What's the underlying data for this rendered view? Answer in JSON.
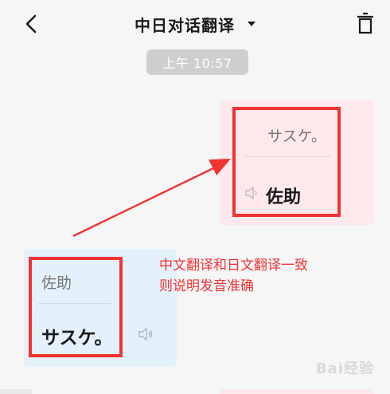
{
  "header": {
    "title": "中日对话翻译",
    "back_icon": "chevron-left-icon",
    "dropdown_icon": "caret-down-icon",
    "delete_icon": "trash-icon"
  },
  "timestamp": "上午 10:57",
  "messages": [
    {
      "side": "right",
      "source_text": "サスケ。",
      "translated_text": "佐助",
      "bubble_color": "#fde9ec"
    },
    {
      "side": "left",
      "source_text": "佐助",
      "translated_text": "サスケ。",
      "bubble_color": "#e3f1fb"
    }
  ],
  "annotation": {
    "line1": "中文翻译和日文翻译一致",
    "line2": "则说明发音准确",
    "color": "#ef3333"
  },
  "watermark": "Bai经验"
}
